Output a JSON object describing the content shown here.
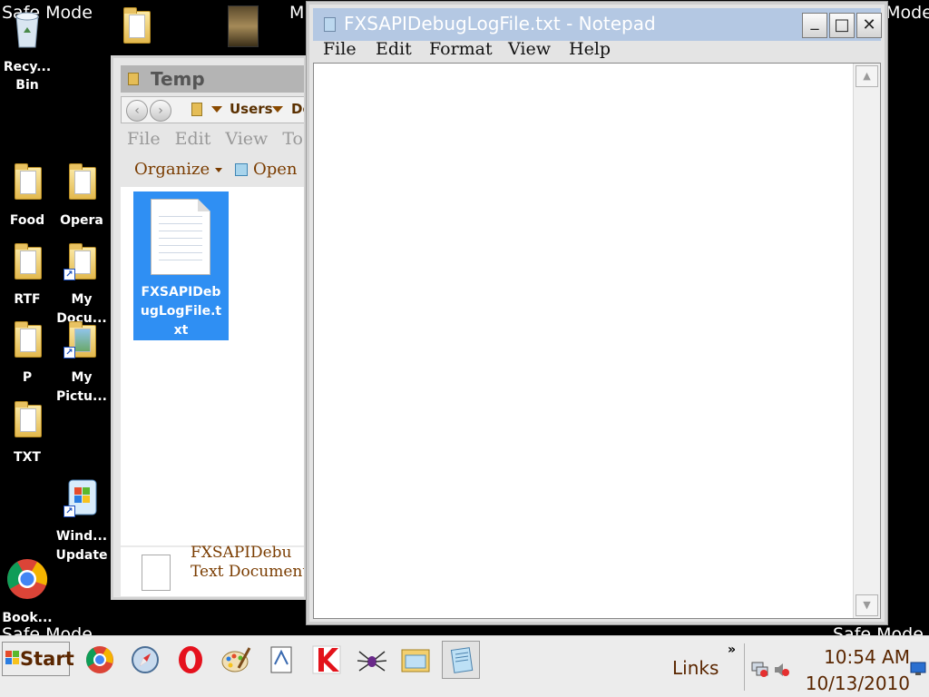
{
  "desktop": {
    "safe_mode": "Safe Mode",
    "clipped_label": "M",
    "icons": [
      {
        "id": "recycle",
        "label": "Recy... Bin"
      },
      {
        "id": "food",
        "label": "Food"
      },
      {
        "id": "opera",
        "label": "Opera"
      },
      {
        "id": "rtf",
        "label": "RTF"
      },
      {
        "id": "mydocs",
        "label": "My Docu..."
      },
      {
        "id": "p",
        "label": "P"
      },
      {
        "id": "mypics",
        "label": "My Pictu..."
      },
      {
        "id": "txt",
        "label": "TXT"
      },
      {
        "id": "winupdate",
        "label": "Wind... Update"
      },
      {
        "id": "chrome",
        "label": "Book..."
      }
    ]
  },
  "explorer": {
    "title": "Temp",
    "breadcrumb": [
      "Users",
      "Do"
    ],
    "menu": [
      "File",
      "Edit",
      "View",
      "Tool"
    ],
    "toolbar": {
      "organize": "Organize",
      "open": "Open"
    },
    "selected_file": "FXSAPIDebugLogFile.txt",
    "details": {
      "name": "FXSAPIDebu",
      "type": "Text Document"
    }
  },
  "notepad": {
    "title": "FXSAPIDebugLogFile.txt - Notepad",
    "menu": [
      "File",
      "Edit",
      "Format",
      "View",
      "Help"
    ],
    "content": "",
    "caption_buttons": {
      "minimize": "_",
      "maximize": "□",
      "close": "✕"
    }
  },
  "taskbar": {
    "start": "Start",
    "links": "Links",
    "chevron": "»",
    "time": "10:54 AM",
    "date": "10/13/2010",
    "apps": [
      "chrome",
      "safari",
      "opera",
      "paint",
      "document",
      "kaspersky",
      "spider",
      "explorer",
      "notepad"
    ]
  }
}
